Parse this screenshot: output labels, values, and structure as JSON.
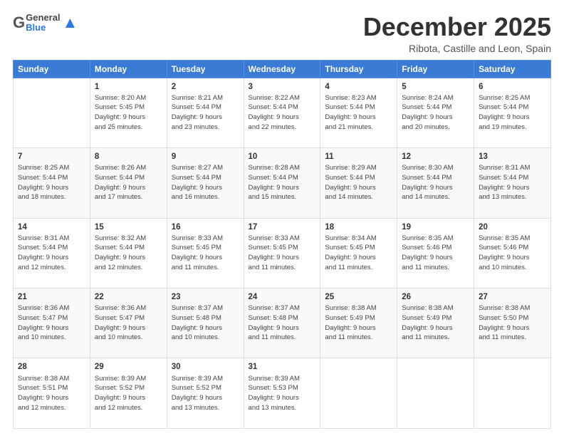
{
  "header": {
    "logo_general": "General",
    "logo_blue": "Blue",
    "month": "December 2025",
    "location": "Ribota, Castille and Leon, Spain"
  },
  "days_of_week": [
    "Sunday",
    "Monday",
    "Tuesday",
    "Wednesday",
    "Thursday",
    "Friday",
    "Saturday"
  ],
  "weeks": [
    [
      {
        "num": "",
        "info": ""
      },
      {
        "num": "1",
        "info": "Sunrise: 8:20 AM\nSunset: 5:45 PM\nDaylight: 9 hours\nand 25 minutes."
      },
      {
        "num": "2",
        "info": "Sunrise: 8:21 AM\nSunset: 5:44 PM\nDaylight: 9 hours\nand 23 minutes."
      },
      {
        "num": "3",
        "info": "Sunrise: 8:22 AM\nSunset: 5:44 PM\nDaylight: 9 hours\nand 22 minutes."
      },
      {
        "num": "4",
        "info": "Sunrise: 8:23 AM\nSunset: 5:44 PM\nDaylight: 9 hours\nand 21 minutes."
      },
      {
        "num": "5",
        "info": "Sunrise: 8:24 AM\nSunset: 5:44 PM\nDaylight: 9 hours\nand 20 minutes."
      },
      {
        "num": "6",
        "info": "Sunrise: 8:25 AM\nSunset: 5:44 PM\nDaylight: 9 hours\nand 19 minutes."
      }
    ],
    [
      {
        "num": "7",
        "info": "Sunrise: 8:25 AM\nSunset: 5:44 PM\nDaylight: 9 hours\nand 18 minutes."
      },
      {
        "num": "8",
        "info": "Sunrise: 8:26 AM\nSunset: 5:44 PM\nDaylight: 9 hours\nand 17 minutes."
      },
      {
        "num": "9",
        "info": "Sunrise: 8:27 AM\nSunset: 5:44 PM\nDaylight: 9 hours\nand 16 minutes."
      },
      {
        "num": "10",
        "info": "Sunrise: 8:28 AM\nSunset: 5:44 PM\nDaylight: 9 hours\nand 15 minutes."
      },
      {
        "num": "11",
        "info": "Sunrise: 8:29 AM\nSunset: 5:44 PM\nDaylight: 9 hours\nand 14 minutes."
      },
      {
        "num": "12",
        "info": "Sunrise: 8:30 AM\nSunset: 5:44 PM\nDaylight: 9 hours\nand 14 minutes."
      },
      {
        "num": "13",
        "info": "Sunrise: 8:31 AM\nSunset: 5:44 PM\nDaylight: 9 hours\nand 13 minutes."
      }
    ],
    [
      {
        "num": "14",
        "info": "Sunrise: 8:31 AM\nSunset: 5:44 PM\nDaylight: 9 hours\nand 12 minutes."
      },
      {
        "num": "15",
        "info": "Sunrise: 8:32 AM\nSunset: 5:44 PM\nDaylight: 9 hours\nand 12 minutes."
      },
      {
        "num": "16",
        "info": "Sunrise: 8:33 AM\nSunset: 5:45 PM\nDaylight: 9 hours\nand 11 minutes."
      },
      {
        "num": "17",
        "info": "Sunrise: 8:33 AM\nSunset: 5:45 PM\nDaylight: 9 hours\nand 11 minutes."
      },
      {
        "num": "18",
        "info": "Sunrise: 8:34 AM\nSunset: 5:45 PM\nDaylight: 9 hours\nand 11 minutes."
      },
      {
        "num": "19",
        "info": "Sunrise: 8:35 AM\nSunset: 5:46 PM\nDaylight: 9 hours\nand 11 minutes."
      },
      {
        "num": "20",
        "info": "Sunrise: 8:35 AM\nSunset: 5:46 PM\nDaylight: 9 hours\nand 10 minutes."
      }
    ],
    [
      {
        "num": "21",
        "info": "Sunrise: 8:36 AM\nSunset: 5:47 PM\nDaylight: 9 hours\nand 10 minutes."
      },
      {
        "num": "22",
        "info": "Sunrise: 8:36 AM\nSunset: 5:47 PM\nDaylight: 9 hours\nand 10 minutes."
      },
      {
        "num": "23",
        "info": "Sunrise: 8:37 AM\nSunset: 5:48 PM\nDaylight: 9 hours\nand 10 minutes."
      },
      {
        "num": "24",
        "info": "Sunrise: 8:37 AM\nSunset: 5:48 PM\nDaylight: 9 hours\nand 11 minutes."
      },
      {
        "num": "25",
        "info": "Sunrise: 8:38 AM\nSunset: 5:49 PM\nDaylight: 9 hours\nand 11 minutes."
      },
      {
        "num": "26",
        "info": "Sunrise: 8:38 AM\nSunset: 5:49 PM\nDaylight: 9 hours\nand 11 minutes."
      },
      {
        "num": "27",
        "info": "Sunrise: 8:38 AM\nSunset: 5:50 PM\nDaylight: 9 hours\nand 11 minutes."
      }
    ],
    [
      {
        "num": "28",
        "info": "Sunrise: 8:38 AM\nSunset: 5:51 PM\nDaylight: 9 hours\nand 12 minutes."
      },
      {
        "num": "29",
        "info": "Sunrise: 8:39 AM\nSunset: 5:52 PM\nDaylight: 9 hours\nand 12 minutes."
      },
      {
        "num": "30",
        "info": "Sunrise: 8:39 AM\nSunset: 5:52 PM\nDaylight: 9 hours\nand 13 minutes."
      },
      {
        "num": "31",
        "info": "Sunrise: 8:39 AM\nSunset: 5:53 PM\nDaylight: 9 hours\nand 13 minutes."
      },
      {
        "num": "",
        "info": ""
      },
      {
        "num": "",
        "info": ""
      },
      {
        "num": "",
        "info": ""
      }
    ]
  ]
}
